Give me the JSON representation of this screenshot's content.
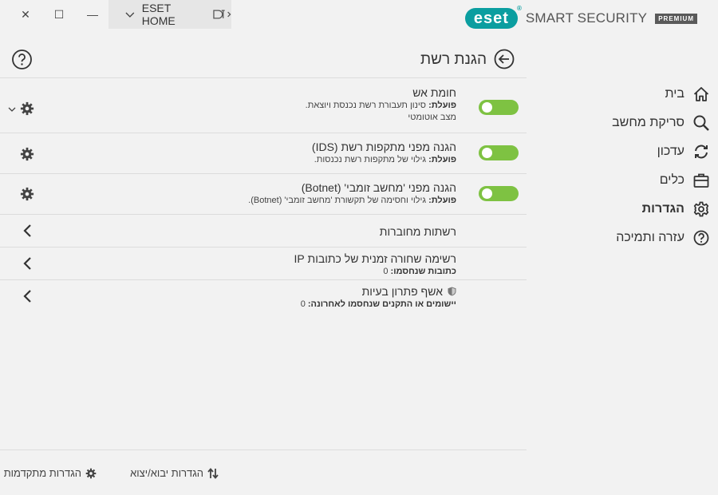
{
  "window": {
    "close_symbol": "✕",
    "maximize_symbol": "☐",
    "minimize_symbol": "—"
  },
  "eset_home": {
    "label": "ESET HOME"
  },
  "brand": {
    "logo": "eset",
    "product": "SMART SECURITY",
    "edition": "PREMIUM",
    "accent": "#0b9ea0"
  },
  "page": {
    "title": "הגנת רשת"
  },
  "rows": [
    {
      "title": "חומת אש",
      "status_label": "פועלת:",
      "status_text": " סינון תעבורת רשת נכנסת ויוצאת.",
      "mode": "מצב אוטומטי"
    },
    {
      "title": "הגנה מפני מתקפות רשת (IDS)",
      "status_label": "פועלת:",
      "status_text": " גילוי של מתקפות רשת נכנסות."
    },
    {
      "title": "הגנה מפני 'מחשב זומבי' (Botnet)",
      "status_label": "פועלת:",
      "status_text": " גילוי וחסימה של תקשורת 'מחשב זומבי' (Botnet)."
    },
    {
      "title": "רשתות מחוברות"
    },
    {
      "title": "רשימה שחורה זמנית של כתובות IP",
      "count_label": "כתובות שנחסמו:",
      "count_value": " 0"
    },
    {
      "title": "אשף פתרון בעיות",
      "count_label": "יישומים או התקנים שנחסמו לאחרונה:",
      "count_value": " 0"
    }
  ],
  "footer": {
    "import_export": "הגדרות יבוא/יצוא",
    "advanced": "הגדרות מתקדמות"
  },
  "sidebar": {
    "items": [
      {
        "label": "בית",
        "icon": "home-icon"
      },
      {
        "label": "סריקת מחשב",
        "icon": "search-icon"
      },
      {
        "label": "עדכון",
        "icon": "update-icon"
      },
      {
        "label": "כלים",
        "icon": "tools-icon"
      },
      {
        "label": "הגדרות",
        "icon": "gear-icon",
        "active": true
      },
      {
        "label": "עזרה ותמיכה",
        "icon": "help-icon"
      }
    ]
  },
  "colors": {
    "toggle_on": "#7ec242",
    "background": "#f2f2f2"
  }
}
